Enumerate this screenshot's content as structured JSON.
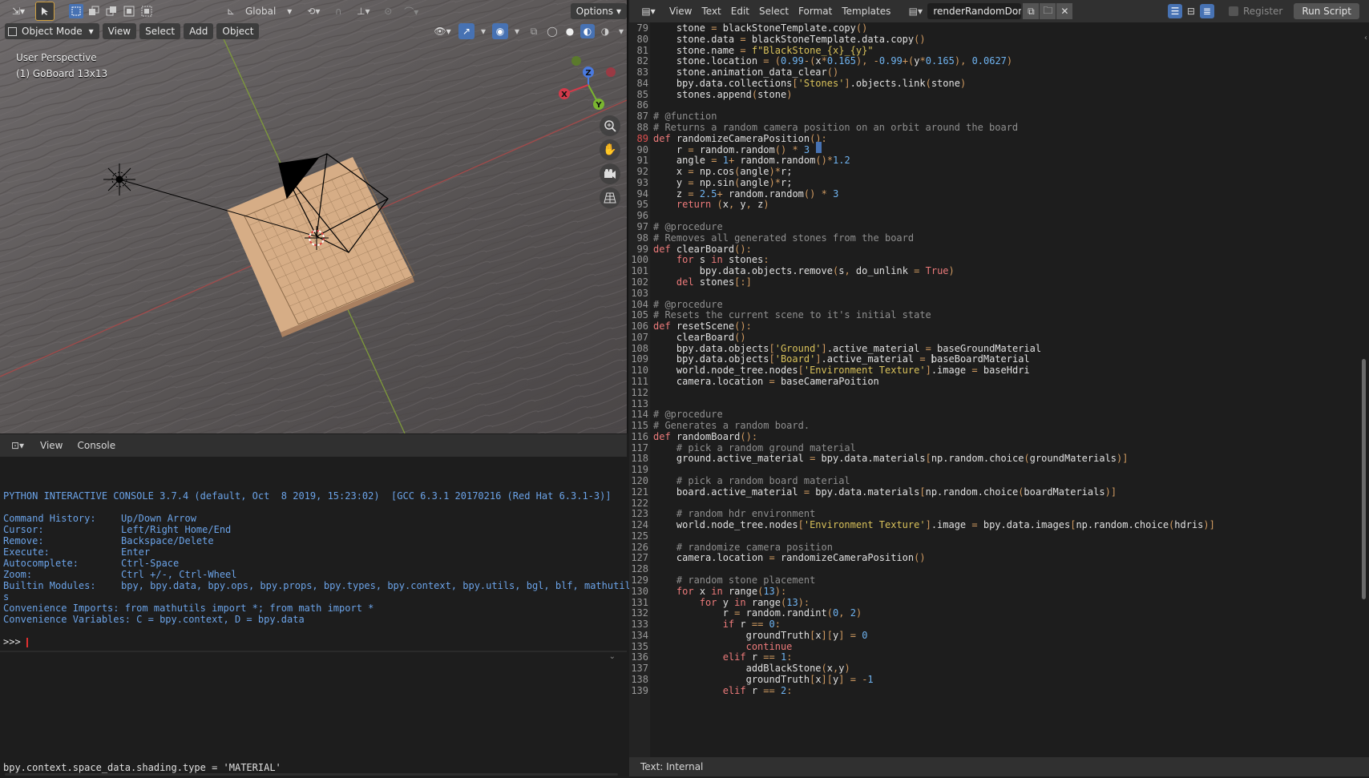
{
  "viewport": {
    "mode_label": "Object Mode",
    "menus": [
      "View",
      "Select",
      "Add",
      "Object"
    ],
    "transform_orientation": "Global",
    "options_label": "Options",
    "perspective_label": "User Perspective",
    "object_label": "(1) GoBoard 13x13",
    "gizmo": {
      "x_label": "X",
      "y_label": "Y",
      "z_label": "Z"
    }
  },
  "console": {
    "menus": [
      "View",
      "Console"
    ],
    "banner": "PYTHON INTERACTIVE CONSOLE 3.7.4 (default, Oct  8 2019, 15:23:02)  [GCC 6.3.1 20170216 (Red Hat 6.3.1-3)]",
    "help": [
      {
        "key": "Command History:",
        "value": "Up/Down Arrow"
      },
      {
        "key": "Cursor:",
        "value": "Left/Right Home/End"
      },
      {
        "key": "Remove:",
        "value": "Backspace/Delete"
      },
      {
        "key": "Execute:",
        "value": "Enter"
      },
      {
        "key": "Autocomplete:",
        "value": "Ctrl-Space"
      },
      {
        "key": "Zoom:",
        "value": "Ctrl +/-, Ctrl-Wheel"
      },
      {
        "key": "Builtin Modules:",
        "value": "bpy, bpy.data, bpy.ops, bpy.props, bpy.types, bpy.context, bpy.utils, bgl, blf, mathutil"
      }
    ],
    "wrap_char": "s",
    "imports": "Convenience Imports: from mathutils import *; from math import *",
    "variables": "Convenience Variables: C = bpy.context, D = bpy.data",
    "prompt": ">>> ",
    "info_line": "bpy.context.space_data.shading.type = 'MATERIAL'"
  },
  "editor": {
    "menus": [
      "View",
      "Text",
      "Edit",
      "Select",
      "Format",
      "Templates"
    ],
    "filename": "renderRandomDom...",
    "register_label": "Register",
    "run_label": "Run Script",
    "footer": "Text: Internal",
    "current_line": 89,
    "lines": [
      {
        "n": "79",
        "t": "    stone = blackStoneTemplate.copy()"
      },
      {
        "n": "80",
        "t": "    stone.data = blackStoneTemplate.data.copy()"
      },
      {
        "n": "81",
        "t": "    stone.name = f\"BlackStone_{x}_{y}\""
      },
      {
        "n": "82",
        "t": "    stone.location = (0.99-(x*0.165), -0.99+(y*0.165), 0.0627)"
      },
      {
        "n": "83",
        "t": "    stone.animation_data_clear()"
      },
      {
        "n": "84",
        "t": "    bpy.data.collections['Stones'].objects.link(stone)"
      },
      {
        "n": "85",
        "t": "    stones.append(stone)"
      },
      {
        "n": "86",
        "t": ""
      },
      {
        "n": "87",
        "t": "# @function"
      },
      {
        "n": "88",
        "t": "# Returns a random camera position on an orbit around the board"
      },
      {
        "n": "89",
        "t": "def randomizeCameraPosition():"
      },
      {
        "n": "90",
        "t": "    r = random.random() * 3"
      },
      {
        "n": "91",
        "t": "    angle = 1+ random.random()*1.2"
      },
      {
        "n": "92",
        "t": "    x = np.cos(angle)*r;"
      },
      {
        "n": "93",
        "t": "    y = np.sin(angle)*r;"
      },
      {
        "n": "94",
        "t": "    z = 2.5+ random.random() * 3"
      },
      {
        "n": "95",
        "t": "    return (x, y, z)"
      },
      {
        "n": "96",
        "t": ""
      },
      {
        "n": "97",
        "t": "# @procedure"
      },
      {
        "n": "98",
        "t": "# Removes all generated stones from the board"
      },
      {
        "n": "99",
        "t": "def clearBoard():"
      },
      {
        "n": "100",
        "t": "    for s in stones:"
      },
      {
        "n": "101",
        "t": "        bpy.data.objects.remove(s, do_unlink = True)"
      },
      {
        "n": "102",
        "t": "    del stones[:]"
      },
      {
        "n": "103",
        "t": ""
      },
      {
        "n": "104",
        "t": "# @procedure"
      },
      {
        "n": "105",
        "t": "# Resets the current scene to it's initial state"
      },
      {
        "n": "106",
        "t": "def resetScene():"
      },
      {
        "n": "107",
        "t": "    clearBoard()"
      },
      {
        "n": "108",
        "t": "    bpy.data.objects['Ground'].active_material = baseGroundMaterial"
      },
      {
        "n": "109",
        "t": "    bpy.data.objects['Board'].active_material = baseBoardMaterial"
      },
      {
        "n": "110",
        "t": "    world.node_tree.nodes['Environment Texture'].image = baseHdri"
      },
      {
        "n": "111",
        "t": "    camera.location = baseCameraPoition"
      },
      {
        "n": "112",
        "t": ""
      },
      {
        "n": "113",
        "t": ""
      },
      {
        "n": "114",
        "t": "# @procedure"
      },
      {
        "n": "115",
        "t": "# Generates a random board."
      },
      {
        "n": "116",
        "t": "def randomBoard():"
      },
      {
        "n": "117",
        "t": "    # pick a random ground material"
      },
      {
        "n": "118",
        "t": "    ground.active_material = bpy.data.materials[np.random.choice(groundMaterials)]"
      },
      {
        "n": "119",
        "t": ""
      },
      {
        "n": "120",
        "t": "    # pick a random board material"
      },
      {
        "n": "121",
        "t": "    board.active_material = bpy.data.materials[np.random.choice(boardMaterials)]"
      },
      {
        "n": "122",
        "t": ""
      },
      {
        "n": "123",
        "t": "    # random hdr environment"
      },
      {
        "n": "124",
        "t": "    world.node_tree.nodes['Environment Texture'].image = bpy.data.images[np.random.choice(hdris)]"
      },
      {
        "n": "125",
        "t": ""
      },
      {
        "n": "126",
        "t": "    # randomize camera position"
      },
      {
        "n": "127",
        "t": "    camera.location = randomizeCameraPosition()"
      },
      {
        "n": "128",
        "t": ""
      },
      {
        "n": "129",
        "t": "    # random stone placement"
      },
      {
        "n": "130",
        "t": "    for x in range(13):"
      },
      {
        "n": "131",
        "t": "        for y in range(13):"
      },
      {
        "n": "132",
        "t": "            r = random.randint(0, 2)"
      },
      {
        "n": "133",
        "t": "            if r == 0:"
      },
      {
        "n": "134",
        "t": "                groundTruth[x][y] = 0"
      },
      {
        "n": "135",
        "t": "                continue"
      },
      {
        "n": "136",
        "t": "            elif r == 1:"
      },
      {
        "n": "137",
        "t": "                addBlackStone(x,y)"
      },
      {
        "n": "138",
        "t": "                groundTruth[x][y] = -1"
      },
      {
        "n": "139",
        "t": "            elif r == 2:"
      }
    ]
  },
  "colors": {
    "keyword": "#ec7a7a",
    "comment": "#8f8f8f",
    "string": "#d8c15a",
    "number": "#6fb3f0",
    "console_text": "#6ba3e8"
  }
}
